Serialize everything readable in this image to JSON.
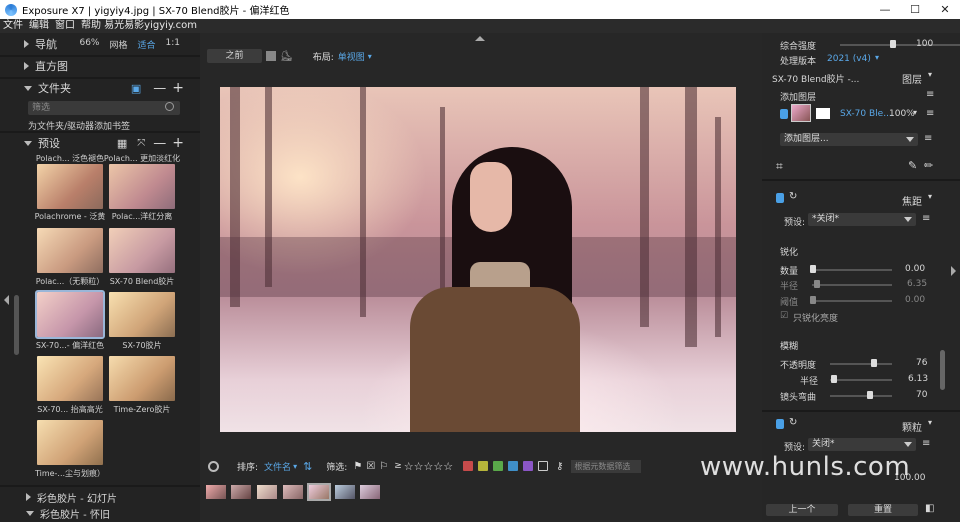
{
  "window": {
    "title": "Exposure X7 | yigyiy4.jpg | SX-70 Blend胶片 - 偏洋红色",
    "min": "—",
    "max": "☐",
    "close": "✕"
  },
  "menu": {
    "items": [
      "文件",
      "编辑",
      "窗口",
      "帮助 易光易影yigyiy.com"
    ]
  },
  "left": {
    "navigator": {
      "label": "导航",
      "zoom": "66%",
      "grid": "网格",
      "fit": "适合",
      "ratio": "1:1"
    },
    "histogram": {
      "label": "直方图"
    },
    "folders": {
      "label": "文件夹",
      "filter_placeholder": "筛选",
      "hint": "为文件夹/驱动器添加书签"
    },
    "presets": {
      "label": "预设",
      "top_labels": [
        "Polach... 泛色褪色",
        "Polach... 更加淡红化"
      ],
      "items": [
        {
          "label": "Polachrome - 泛黄"
        },
        {
          "label": "Polac...洋红分离"
        },
        {
          "label": "Polac...（无颗粒）"
        },
        {
          "label": "SX-70 Blend胶片"
        },
        {
          "label": "SX-70...- 偏洋红色"
        },
        {
          "label": "SX-70胶片"
        },
        {
          "label": "SX-70... 抬高高光"
        },
        {
          "label": "Time-Zero胶片"
        },
        {
          "label": "Time-...尘与划痕）"
        }
      ],
      "groups": [
        "彩色胶片 - 幻灯片",
        "彩色胶片 - 怀旧"
      ]
    }
  },
  "center": {
    "before_label": "之前",
    "layout_label": "布局:",
    "layout_value": "单视图",
    "sort_label": "排序:",
    "sort_value": "文件名",
    "filter_label": "筛选:",
    "rating_ge": "≥",
    "stars": "☆☆☆☆☆",
    "meta_search": "根据元数据筛选",
    "color_chips": [
      "#c64b4b",
      "#b6b43a",
      "#5aa84a",
      "#3f8fc8",
      "#8b56c6"
    ]
  },
  "right": {
    "strength_label": "综合强度",
    "strength_value": "100",
    "version_label": "处理版本",
    "version_value": "2021 (v4)",
    "preset_name": "SX-70 Blend胶片 -...",
    "layers_title": "图层",
    "add_layer": "添加图层",
    "layer_name": "SX-70 Ble...",
    "layer_opacity": "100%",
    "add_layer_combo": "添加图层...",
    "focus_title": "焦距",
    "preset_label": "预设:",
    "focus_preset": "*关闭*",
    "sharpen_title": "锐化",
    "amount_label": "数量",
    "amount_value": "0.00",
    "radius_label": "半径",
    "radius_value": "6.35",
    "threshold_label": "阈值",
    "threshold_value": "0.00",
    "sharpen_lum": "只锐化亮度",
    "blur_title": "模糊",
    "opacity_label": "不透明度",
    "opacity_value": "76",
    "blur_radius_label": "半径",
    "blur_radius_value": "6.13",
    "lens_label": "镜头弯曲",
    "lens_value": "70",
    "grain_title": "颗粒",
    "grain_preset": "关闭*",
    "grain_value": "100.00",
    "prev_btn": "上一个",
    "reset_btn": "重置"
  },
  "watermark": "www.hunls.com"
}
